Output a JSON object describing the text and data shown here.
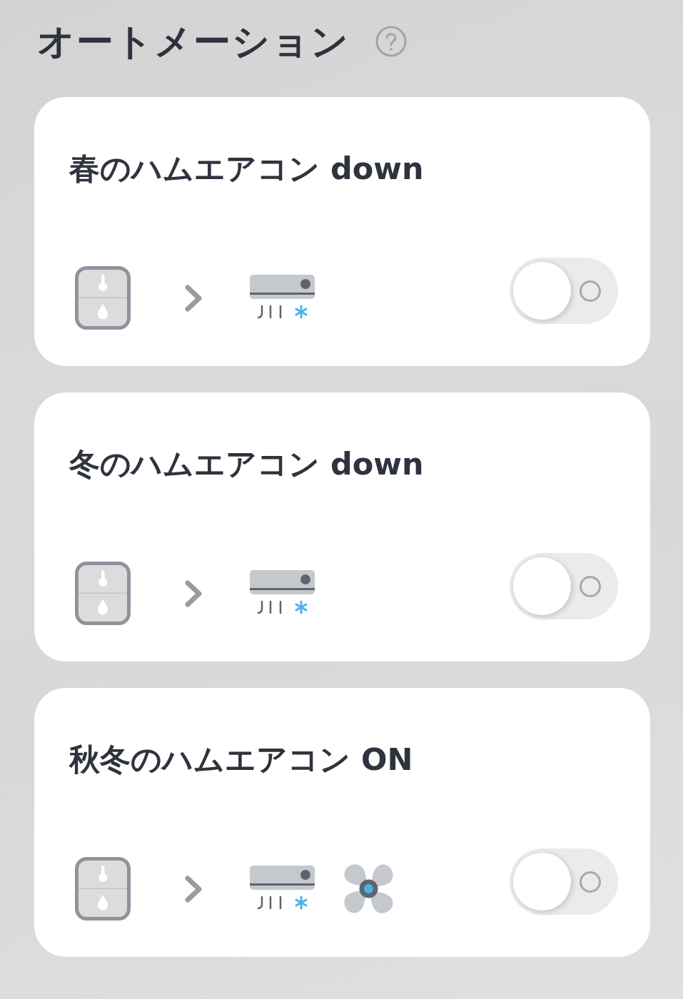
{
  "header": {
    "title": "オートメーション"
  },
  "automations": [
    {
      "title": "春のハムエアコン down",
      "on": false,
      "actions": [
        {
          "kind": "aircon"
        }
      ]
    },
    {
      "title": "冬のハムエアコン down",
      "on": false,
      "actions": [
        {
          "kind": "aircon"
        }
      ]
    },
    {
      "title": "秋冬のハムエアコン ON",
      "on": false,
      "actions": [
        {
          "kind": "aircon"
        },
        {
          "kind": "fan"
        }
      ]
    }
  ]
}
